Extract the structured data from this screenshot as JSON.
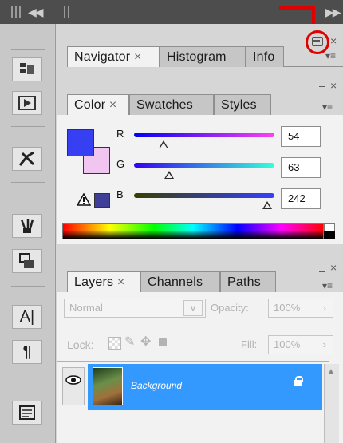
{
  "tabs": {
    "navigator": "Navigator",
    "histogram": "Histogram",
    "info": "Info",
    "color": "Color",
    "swatches": "Swatches",
    "styles": "Styles",
    "layers": "Layers",
    "channels": "Channels",
    "paths": "Paths"
  },
  "tab_close": "×",
  "color": {
    "r_label": "R",
    "r_value": "54",
    "g_label": "G",
    "g_value": "63",
    "b_label": "B",
    "b_value": "242",
    "fg_color": "#363ff2",
    "bg_color": "#f0c6f0",
    "r_level": 0.21,
    "g_level": 0.25,
    "b_level": 0.95
  },
  "layers": {
    "blend_mode": "Normal",
    "opacity_label": "Opacity:",
    "opacity_value": "100%",
    "lock_label": "Lock:",
    "fill_label": "Fill:",
    "fill_value": "100%",
    "layer_name": "Background",
    "selected_color": "#3399ff"
  },
  "icons": {
    "collapse": "collapse-left-arrows",
    "expand": "expand-right-arrows",
    "minimize": "minimize-panel-icon",
    "annotation": "red-arrow-circle"
  },
  "annotation_color": "#e00000"
}
